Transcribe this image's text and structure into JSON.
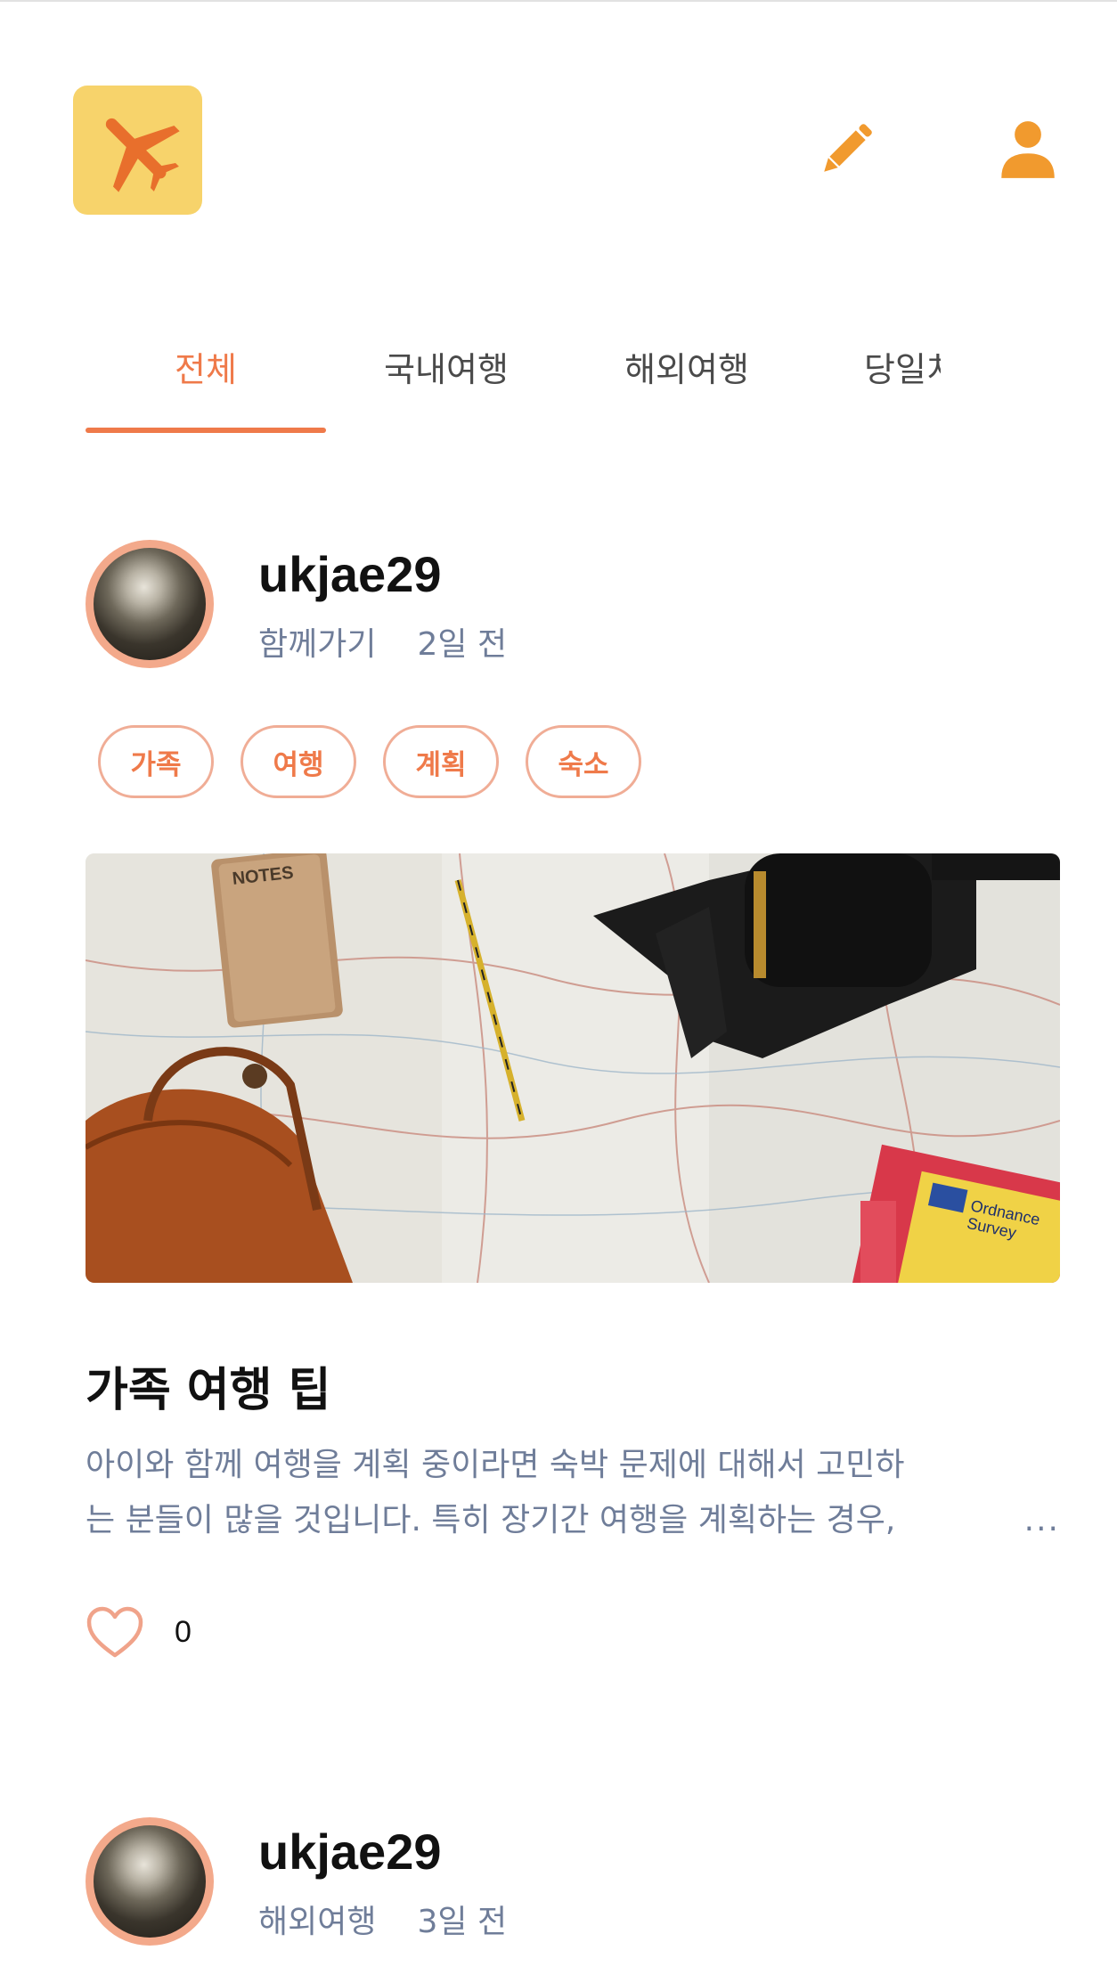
{
  "header": {
    "logo_icon": "airplane-icon",
    "edit_icon": "pencil-icon",
    "profile_icon": "user-icon",
    "accent": "#ef7a4a",
    "logo_bg": "#f7d36b"
  },
  "tabs": [
    {
      "label": "전체",
      "active": true
    },
    {
      "label": "국내여행",
      "active": false
    },
    {
      "label": "해외여행",
      "active": false
    },
    {
      "label": "당일치기",
      "active": false
    }
  ],
  "posts": [
    {
      "username": "ukjae29",
      "category": "함께가기",
      "time": "2일 전",
      "tags": [
        "가족",
        "여행",
        "계획",
        "숙소"
      ],
      "title": "가족 여행 팁",
      "body_line1": "아이와 함께 여행을 계획 중이라면 숙박 문제에 대해서 고민하",
      "body_line2": "는 분들이 많을 것입니다. 특히 장기간 여행을 계획하는 경우,",
      "ellipsis": "...",
      "likes": "0"
    },
    {
      "username": "ukjae29",
      "category": "해외여행",
      "time": "3일 전"
    }
  ]
}
